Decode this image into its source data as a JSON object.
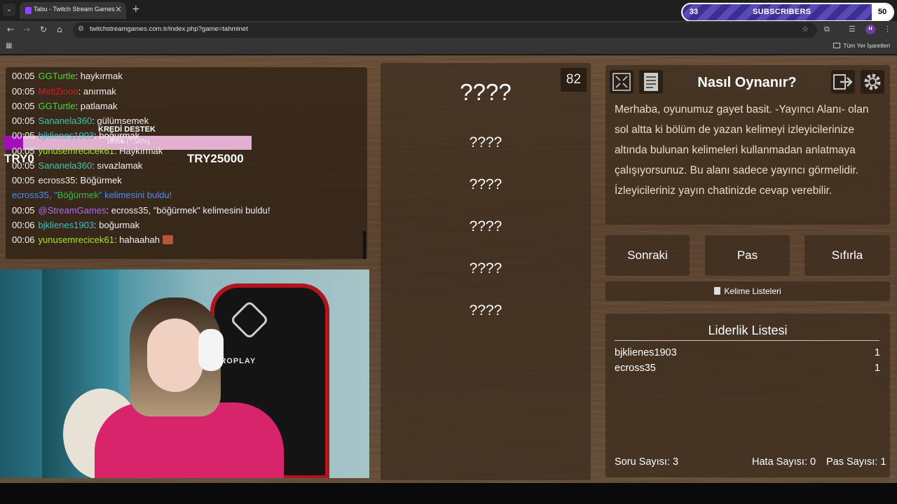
{
  "browser": {
    "tab_title": "Tabu - Twitch Stream Games",
    "url": "twitchstreamgames.com.tr/index.php?game=tahminet",
    "bookmarks_all": "Tüm Yer İşaretleri",
    "profile_initial": "H"
  },
  "subscribers_widget": {
    "left_count": "33",
    "label": "SUBSCRIBERS",
    "right_count": "50",
    "progress_fraction": 0.66
  },
  "chat": [
    {
      "time": "00:05",
      "user": "GGTurtle",
      "color": "#4dd63a",
      "msg": ": haykırmak"
    },
    {
      "time": "00:05",
      "user": "MeltZinoo",
      "color": "#d0202a",
      "msg": ": anırmak"
    },
    {
      "time": "00:05",
      "user": "GGTurtle",
      "color": "#4dd63a",
      "msg": ": patlamak"
    },
    {
      "time": "00:05",
      "user": "Sananela360",
      "color": "#41c4a8",
      "msg": ": gülümsemek"
    },
    {
      "time": "00:05",
      "user": "bjklienes1903",
      "color": "#40c0c0",
      "msg": ": boğurmak"
    },
    {
      "time": "00:05",
      "user": "yunusemrecicek61",
      "color": "#a8e51f",
      "msg": ": Haykırmak"
    },
    {
      "time": "00:05",
      "user": "Sananela360",
      "color": "#41c4a8",
      "msg": ": sıvazlamak"
    },
    {
      "time": "00:05",
      "user": "ecross35",
      "color": "#e8e8e8",
      "msg": ": Böğürmek"
    },
    {
      "time": "00:05",
      "user": "@StreamGames",
      "color": "#b06cf0",
      "msg": ": ecross35, \"böğürmek\" kelimesini buldu!"
    },
    {
      "time": "00:06",
      "user": "bjklienes1903",
      "color": "#40c0c0",
      "msg": ": boğurmak"
    },
    {
      "time": "00:06",
      "user": "yunusemrecicek61",
      "color": "#a8e51f",
      "msg": ": hahaahah"
    }
  ],
  "chat_found_line": {
    "user": "ecross35",
    "user_color": "#4a8ef0",
    "quote_open": ", \"",
    "word": "Böğürmek",
    "word_color": "#2fbf4a",
    "rest": "\" kelimesini buldu!"
  },
  "kredi": {
    "title": "KREDİ DESTEK",
    "bar_text": "1890₺ (7.56%)",
    "min": "TRY0",
    "max": "TRY25000",
    "progress_fraction": 0.0756
  },
  "webcam": {
    "chair_brand": "PROPLAY"
  },
  "game": {
    "timer": "82",
    "main_word": "????",
    "taboo_words": [
      "????",
      "????",
      "????",
      "????",
      "????"
    ]
  },
  "howto": {
    "title": "Nasıl Oynanır?",
    "text": "Merhaba, oyunumuz gayet basit. -Yayıncı Alanı- olan sol altta ki bölüm de yazan kelimeyi izleyicilerinize altında bulunan kelimeleri kullanmadan anlatmaya çalışıyorsunuz. Bu alanı sadece yayıncı görmelidir. İzleyicileriniz yayın chatinizde cevap verebilir."
  },
  "buttons": {
    "next": "Sonraki",
    "pass": "Pas",
    "reset": "Sıfırla",
    "word_lists": "Kelime Listeleri"
  },
  "leaderboard": {
    "title": "Liderlik Listesi",
    "rows": [
      {
        "name": "bjklienes1903",
        "score": "1"
      },
      {
        "name": "ecross35",
        "score": "1"
      }
    ]
  },
  "stats": {
    "questions": "Soru Sayısı: 3",
    "errors": "Hata Sayısı: 0",
    "passes": "Pas Sayısı: 1"
  }
}
